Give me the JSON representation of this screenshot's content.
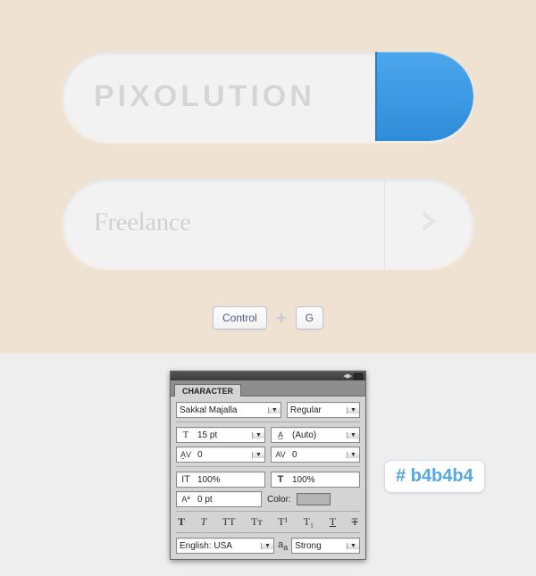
{
  "pills": {
    "pixolution": "PIXOLUTION",
    "freelance": "Freelance"
  },
  "keys": {
    "control": "Control",
    "g": "G"
  },
  "character_panel": {
    "tab": "CHARACTER",
    "font_family": "Sakkal Majalla",
    "font_style": "Regular",
    "size": "15 pt",
    "leading": "(Auto)",
    "kerning": "0",
    "tracking": "0",
    "vscale": "100%",
    "hscale": "100%",
    "baseline": "0 pt",
    "color_label": "Color:",
    "language": "English: USA",
    "antialias": "Strong"
  },
  "hex": "# b4b4b4"
}
